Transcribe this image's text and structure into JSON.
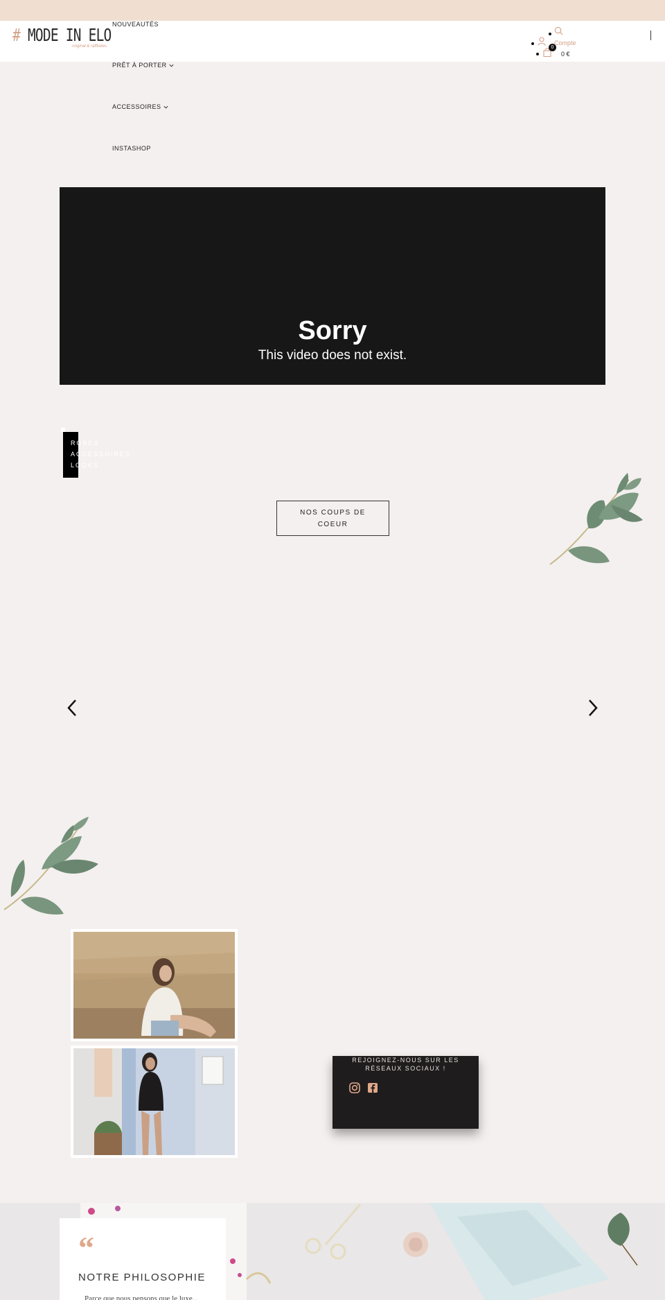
{
  "header": {
    "logo_text": "MODE IN ELO",
    "logo_hash": "#",
    "logo_tagline": "original & raffinées",
    "nav": [
      {
        "label": "NOUVEAUTÉS",
        "has_dropdown": false
      },
      {
        "label": "PRÊT À PORTER",
        "has_dropdown": true
      },
      {
        "label": "ACCESSOIRES",
        "has_dropdown": true
      },
      {
        "label": "INSTASHOP",
        "has_dropdown": false
      }
    ],
    "account_label": "Compte",
    "cart_count": "0",
    "cart_total": "0 €"
  },
  "video": {
    "title": "Sorry",
    "message": "This video does not exist."
  },
  "side_menu": {
    "lines": [
      "ROBES",
      "ACCESSOIRES",
      "LOOKS"
    ]
  },
  "coups_de_coeur": {
    "button_label": "NOS COUPS DE COEUR"
  },
  "social": {
    "title": "REJOIGNEZ-NOUS SUR LES RÉSEAUX SOCIAUX !",
    "networks": [
      "instagram-icon",
      "facebook-icon"
    ]
  },
  "philosophy": {
    "quote_mark": "“",
    "title": "NOTRE PHILOSOPHIE",
    "text": "Parce que nous pensons que le luxe..."
  },
  "colors": {
    "topbar": "#f0dfd1",
    "background": "#f4f0ef",
    "accent": "#d4a088",
    "dark": "#1f1c1d"
  }
}
